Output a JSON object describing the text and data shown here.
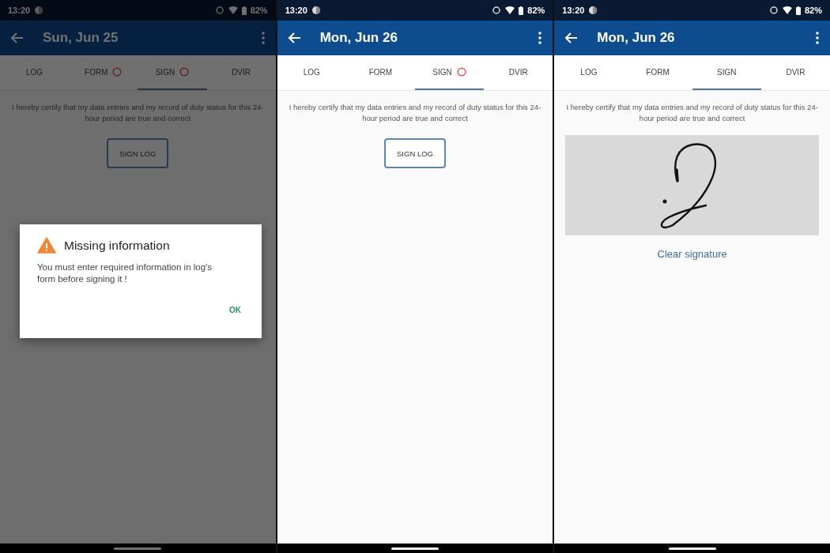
{
  "screens": [
    {
      "kind": "unsigned",
      "status_bar": {
        "time": "13:20",
        "battery": "82%"
      },
      "app_bar": {
        "title": "Sun, Jun 25"
      },
      "tabs": [
        {
          "label": "LOG",
          "selected": false,
          "alert": false
        },
        {
          "label": "FORM",
          "selected": false,
          "alert": true
        },
        {
          "label": "SIGN",
          "selected": true,
          "alert": true
        },
        {
          "label": "DVIR",
          "selected": false,
          "alert": false
        }
      ],
      "certification": "I hereby certify that my data entries and my record of duty status for this 24-hour period are true and correct",
      "sign_button": "SIGN LOG",
      "dialog": {
        "title": "Missing information",
        "message": "You must enter required information in log's form before signing it !",
        "ok_button": "OK"
      }
    },
    {
      "kind": "unsigned",
      "status_bar": {
        "time": "13:20",
        "battery": "82%"
      },
      "app_bar": {
        "title": "Mon, Jun 26"
      },
      "tabs": [
        {
          "label": "LOG",
          "selected": false,
          "alert": false
        },
        {
          "label": "FORM",
          "selected": false,
          "alert": false
        },
        {
          "label": "SIGN",
          "selected": true,
          "alert": true
        },
        {
          "label": "DVIR",
          "selected": false,
          "alert": false
        }
      ],
      "certification": "I hereby certify that my data entries and my record of duty status for this 24-hour period are true and correct",
      "sign_button": "SIGN LOG"
    },
    {
      "kind": "signed",
      "status_bar": {
        "time": "13:20",
        "battery": "82%"
      },
      "app_bar": {
        "title": "Mon, Jun 26"
      },
      "tabs": [
        {
          "label": "LOG",
          "selected": false,
          "alert": false
        },
        {
          "label": "FORM",
          "selected": false,
          "alert": false
        },
        {
          "label": "SIGN",
          "selected": true,
          "alert": false
        },
        {
          "label": "DVIR",
          "selected": false,
          "alert": false
        }
      ],
      "certification": "I hereby certify that my data entries and my record of duty status for this 24-hour period are true and correct",
      "clear_link": "Clear signature"
    }
  ]
}
